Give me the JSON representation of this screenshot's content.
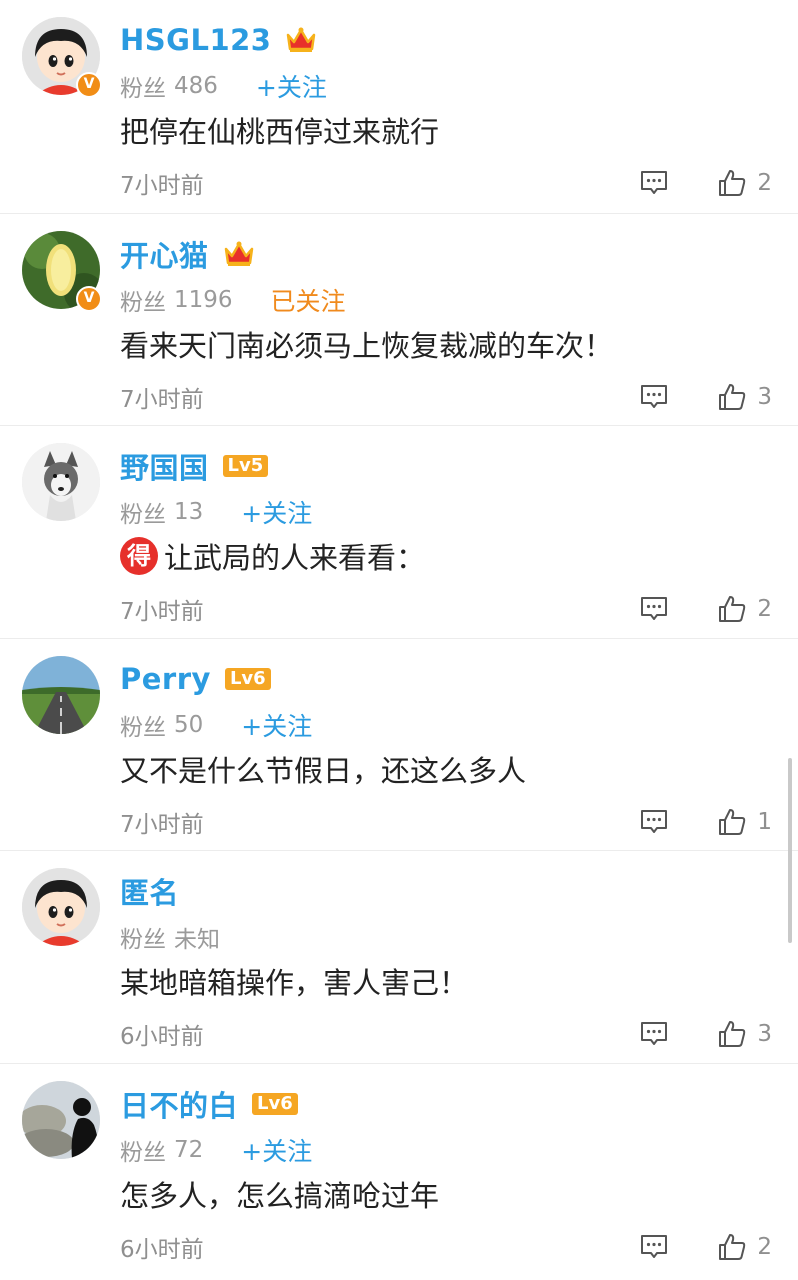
{
  "ui": {
    "fans_label": "粉丝",
    "follow_label": "+关注",
    "followed_label": "已关注"
  },
  "comments": [
    {
      "name": "HSGL123",
      "badge": "crown",
      "fans": "486",
      "follow_state": "follow",
      "text": "把停在仙桃西停过来就行",
      "time": "7小时前",
      "likes": "2",
      "avatar": "cartoon-avatar",
      "verified": "V"
    },
    {
      "name": "开心猫",
      "badge": "crown",
      "fans": "1196",
      "follow_state": "followed",
      "text": "看来天门南必须马上恢复裁减的车次！",
      "time": "7小时前",
      "likes": "3",
      "avatar": "flower-avatar",
      "verified": "V"
    },
    {
      "name": "野国国",
      "badge": "Lv5",
      "fans": "13",
      "follow_state": "follow",
      "prefix_badge": "得",
      "text": "让武局的人来看看：",
      "time": "7小时前",
      "likes": "2",
      "avatar": "husky-avatar"
    },
    {
      "name": "Perry",
      "badge": "Lv6",
      "fans": "50",
      "follow_state": "follow",
      "text": "又不是什么节假日，还这么多人",
      "time": "7小时前",
      "likes": "1",
      "avatar": "road-avatar"
    },
    {
      "name": "匿名",
      "badge": "",
      "fans": "未知",
      "follow_state": "none",
      "text": "某地暗箱操作，害人害己！",
      "time": "6小时前",
      "likes": "3",
      "avatar": "cartoon-avatar"
    },
    {
      "name": "日不的白",
      "badge": "Lv6",
      "fans": "72",
      "follow_state": "follow",
      "text": "怎多人，怎么搞滴呛过年",
      "time": "6小时前",
      "likes": "2",
      "avatar": "silhouette-avatar"
    }
  ],
  "colors": {
    "name": "#2b9be0",
    "follow": "#2b9be0",
    "followed": "#f08a1d",
    "level_badge": "#f5a623",
    "meta": "#9a9a9a"
  }
}
